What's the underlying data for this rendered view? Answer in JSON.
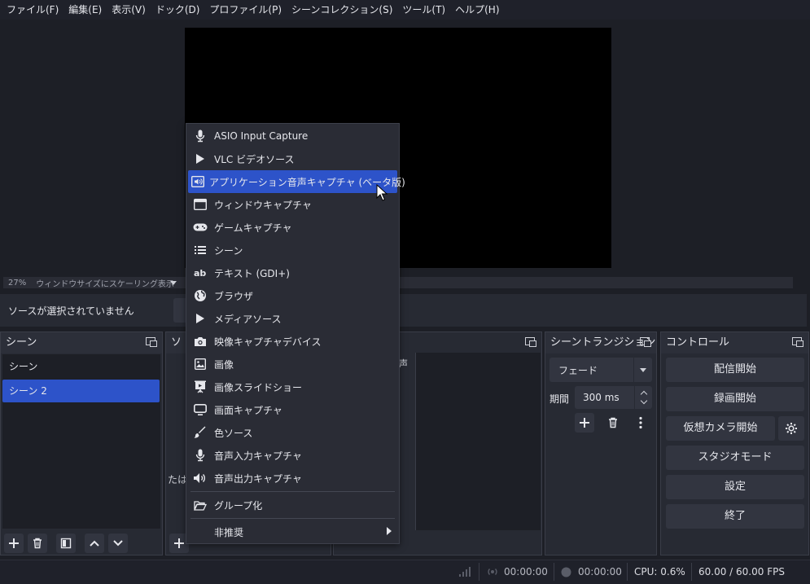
{
  "menubar": {
    "items": [
      "ファイル(F)",
      "編集(E)",
      "表示(V)",
      "ドック(D)",
      "プロファイル(P)",
      "シーンコレクション(S)",
      "ツール(T)",
      "ヘルプ(H)"
    ]
  },
  "preview": {
    "zoom": "27%",
    "scaling_mode": "ウィンドウサイズにスケーリング表示"
  },
  "context_bar": {
    "no_source": "ソースが選択されていません"
  },
  "scenes": {
    "title": "シーン",
    "items": [
      "シーン",
      "シーン 2"
    ],
    "selected_index": 1
  },
  "sources": {
    "title": "ソ",
    "partial_text": "たは"
  },
  "mixer": {
    "partial_text": "声"
  },
  "transitions": {
    "title": "シーントランジション",
    "selected": "フェード",
    "duration_label": "期間",
    "duration_value": "300 ms"
  },
  "controls": {
    "title": "コントロール",
    "start_streaming": "配信開始",
    "start_recording": "録画開始",
    "start_virtualcam": "仮想カメラ開始",
    "studio_mode": "スタジオモード",
    "settings": "設定",
    "exit": "終了"
  },
  "statusbar": {
    "stream_time": "00:00:00",
    "record_time": "00:00:00",
    "cpu": "CPU: 0.6%",
    "fps": "60.00 / 60.00 FPS"
  },
  "add_source_menu": {
    "items": [
      {
        "label": "ASIO Input Capture",
        "icon": "microphone-icon"
      },
      {
        "label": "VLC ビデオソース",
        "icon": "play-icon"
      },
      {
        "label": "アプリケーション音声キャプチャ (ベータ版)",
        "icon": "app-audio-icon"
      },
      {
        "label": "ウィンドウキャプチャ",
        "icon": "window-icon"
      },
      {
        "label": "ゲームキャプチャ",
        "icon": "gamepad-icon"
      },
      {
        "label": "シーン",
        "icon": "list-icon"
      },
      {
        "label": "テキスト (GDI+)",
        "icon": "text-icon"
      },
      {
        "label": "ブラウザ",
        "icon": "globe-icon"
      },
      {
        "label": "メディアソース",
        "icon": "play-icon"
      },
      {
        "label": "映像キャプチャデバイス",
        "icon": "camera-icon"
      },
      {
        "label": "画像",
        "icon": "image-icon"
      },
      {
        "label": "画像スライドショー",
        "icon": "slideshow-icon"
      },
      {
        "label": "画面キャプチャ",
        "icon": "monitor-icon"
      },
      {
        "label": "色ソース",
        "icon": "brush-icon"
      },
      {
        "label": "音声入力キャプチャ",
        "icon": "microphone-icon"
      },
      {
        "label": "音声出力キャプチャ",
        "icon": "speaker-icon"
      }
    ],
    "group": {
      "label": "グループ化",
      "icon": "folder-open-icon"
    },
    "deprecated": {
      "label": "非推奨"
    },
    "highlighted_index": 2
  },
  "colors": {
    "accent": "#2d53c9",
    "background": "#1d1f26",
    "panel": "#272a33",
    "button": "#323540"
  }
}
